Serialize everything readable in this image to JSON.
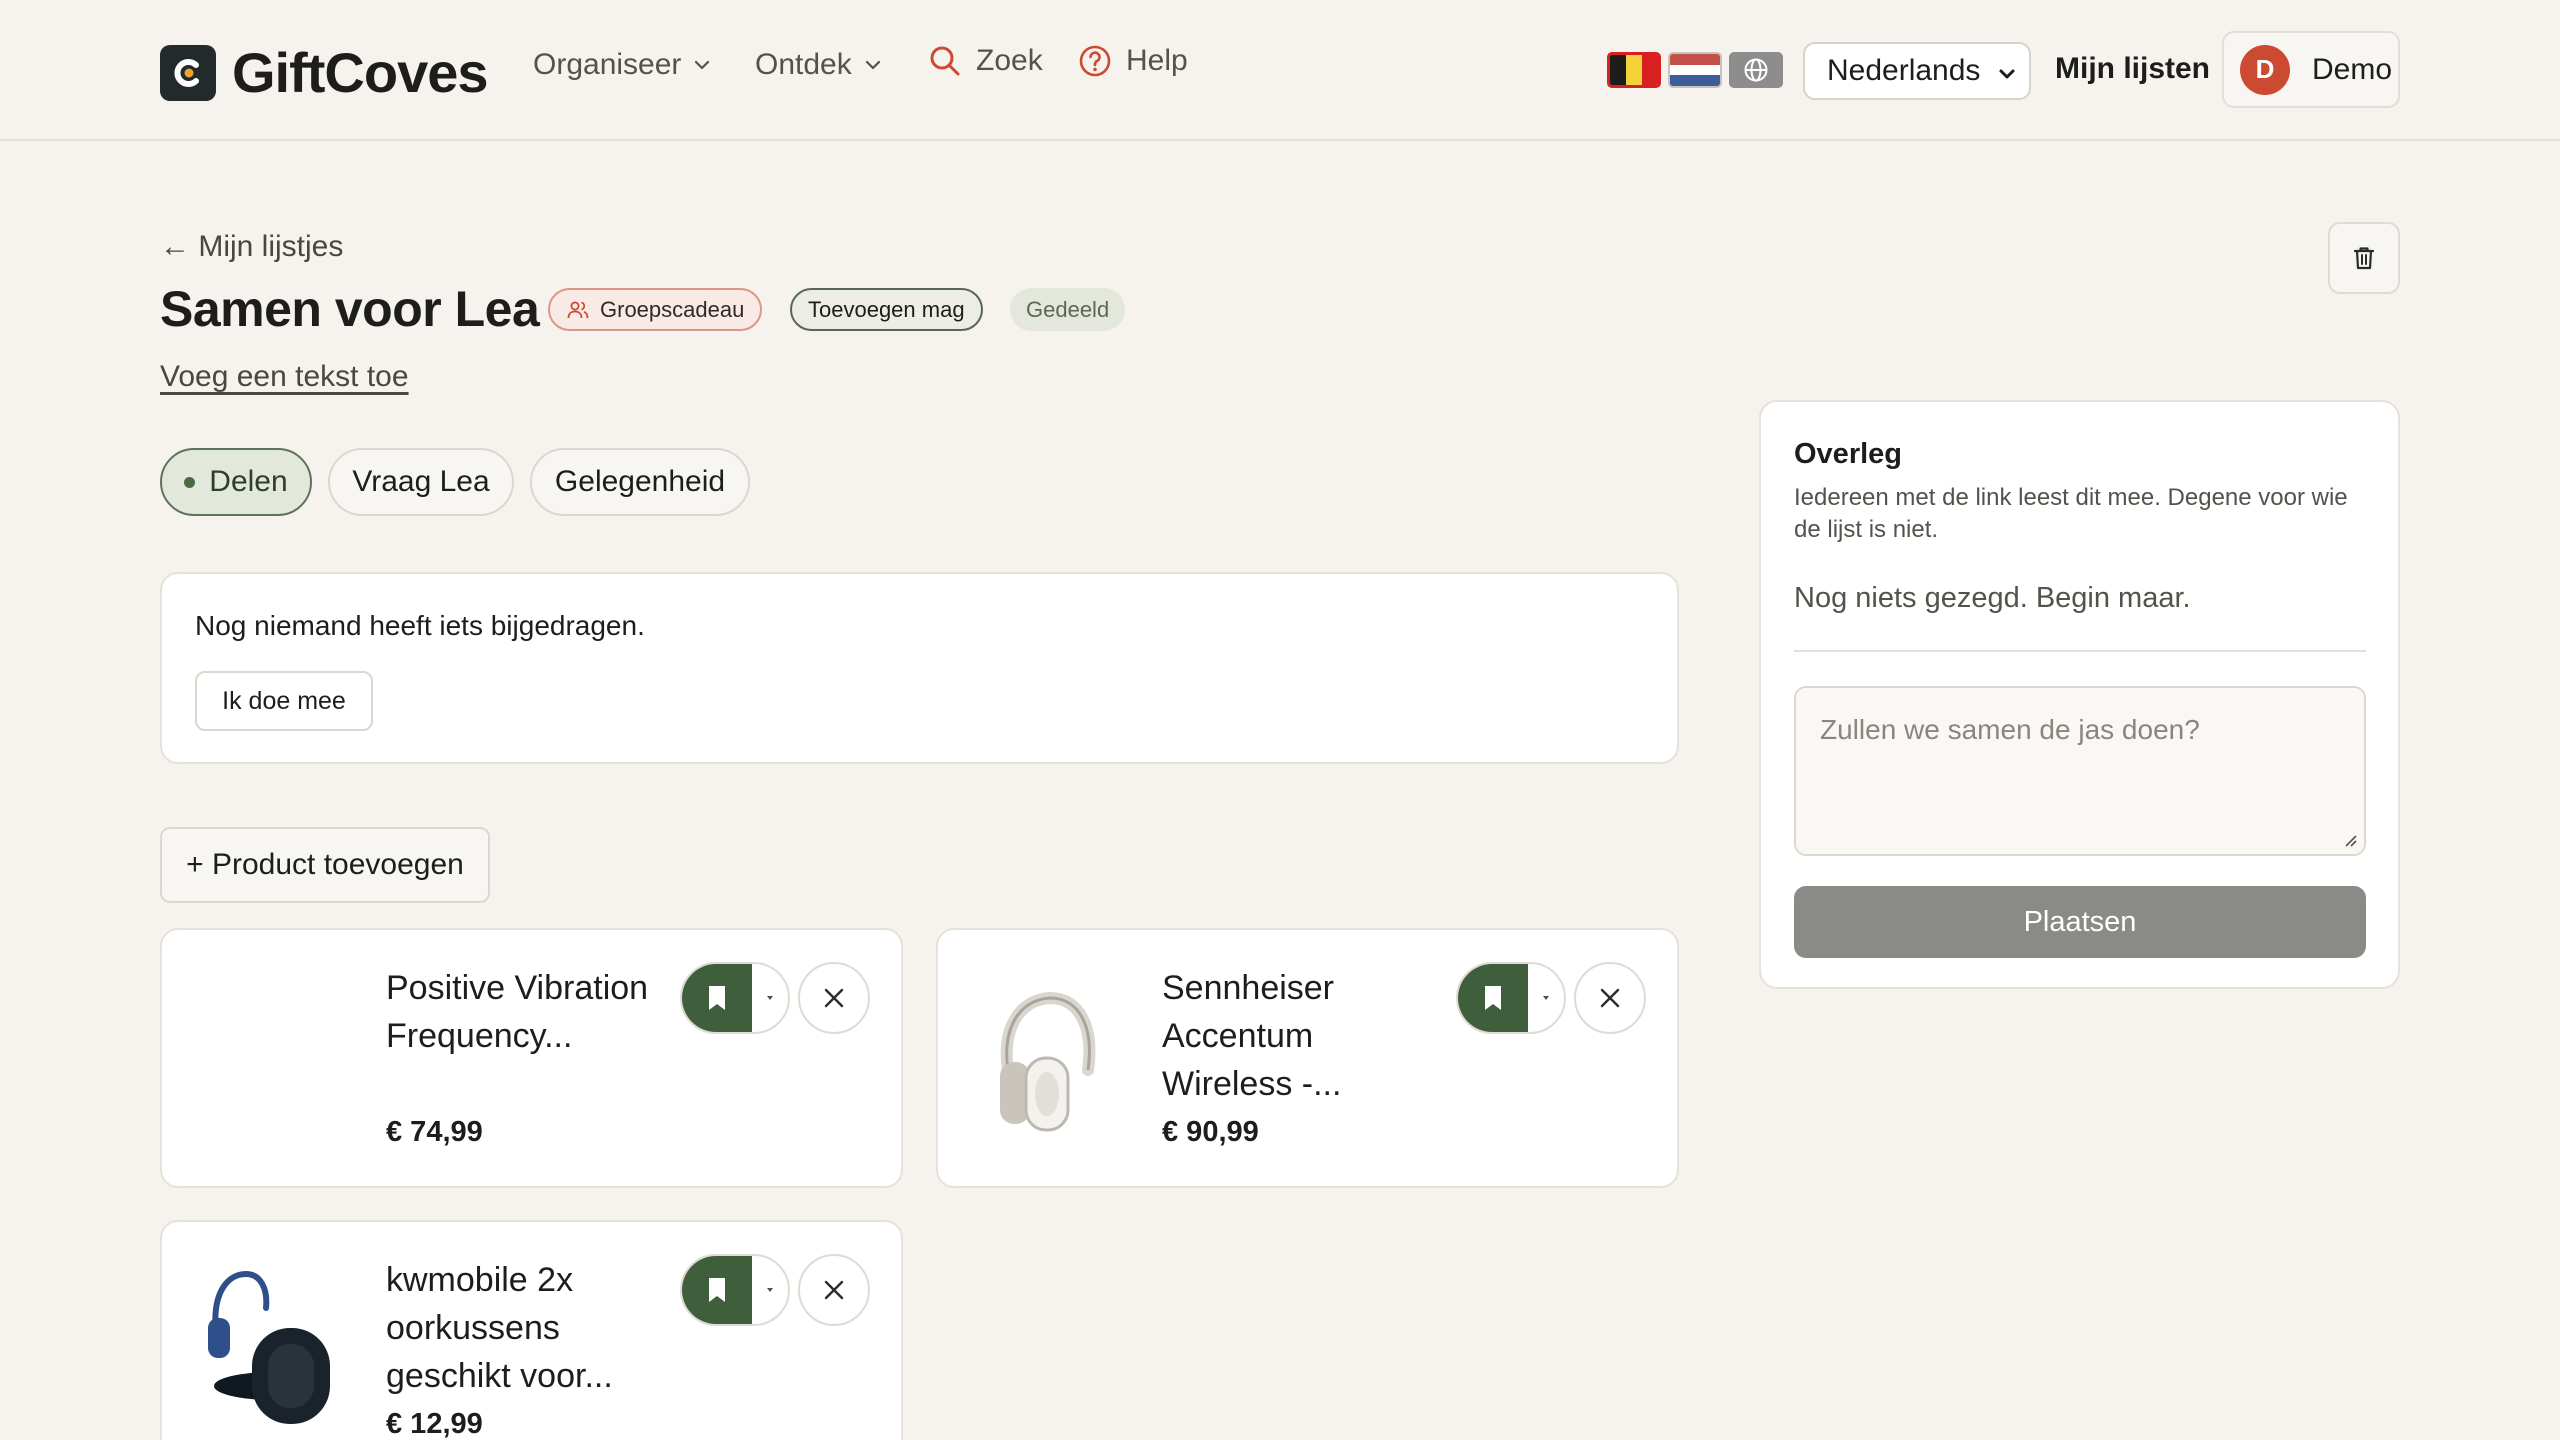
{
  "header": {
    "brand": "GiftCoves",
    "nav": {
      "organiseer": "Organiseer",
      "ontdek": "Ontdek",
      "zoek": "Zoek",
      "help": "Help"
    },
    "language": "Nederlands",
    "my_lists": "Mijn lijsten",
    "user": {
      "initial": "D",
      "name": "Demo"
    }
  },
  "list": {
    "back_link": "← Mijn lijstjes",
    "title": "Samen voor Lea",
    "badges": {
      "group": "Groepscadeau",
      "add_allowed": "Toevoegen mag",
      "shared": "Gedeeld"
    },
    "add_text": "Voeg een tekst toe"
  },
  "tabs": [
    "Delen",
    "Vraag Lea",
    "Gelegenheid"
  ],
  "contribution": {
    "message": "Nog niemand heeft iets bijgedragen.",
    "join_label": "Ik doe mee"
  },
  "add_product_label": "+ Product toevoegen",
  "products": [
    {
      "name": "Positive Vibration Frequency...",
      "price": "€ 74,99",
      "image": "none"
    },
    {
      "name": "Sennheiser Accentum Wireless -...",
      "price": "€ 90,99",
      "image": "white-headphones"
    },
    {
      "name": "kwmobile 2x oorkussens geschikt voor...",
      "price": "€ 12,99",
      "image": "blue-headphones-earpads"
    }
  ],
  "discussion": {
    "title": "Overleg",
    "description": "Iedereen met de link leest dit mee. Degene voor wie de lijst is niet.",
    "empty": "Nog niets gezegd. Begin maar.",
    "placeholder": "Zullen we samen de jas doen?",
    "submit_label": "Plaatsen"
  },
  "colors": {
    "background": "#f6f3ee",
    "accent_green": "#3f5f3c",
    "avatar": "#cc4a31",
    "submit_disabled": "#8a8a87"
  },
  "icons": [
    "logo-icon",
    "chevron-down-icon",
    "search-icon",
    "help-icon",
    "globe-icon",
    "users-icon",
    "trash-icon",
    "bookmark-icon",
    "caret-down-icon",
    "close-icon"
  ]
}
